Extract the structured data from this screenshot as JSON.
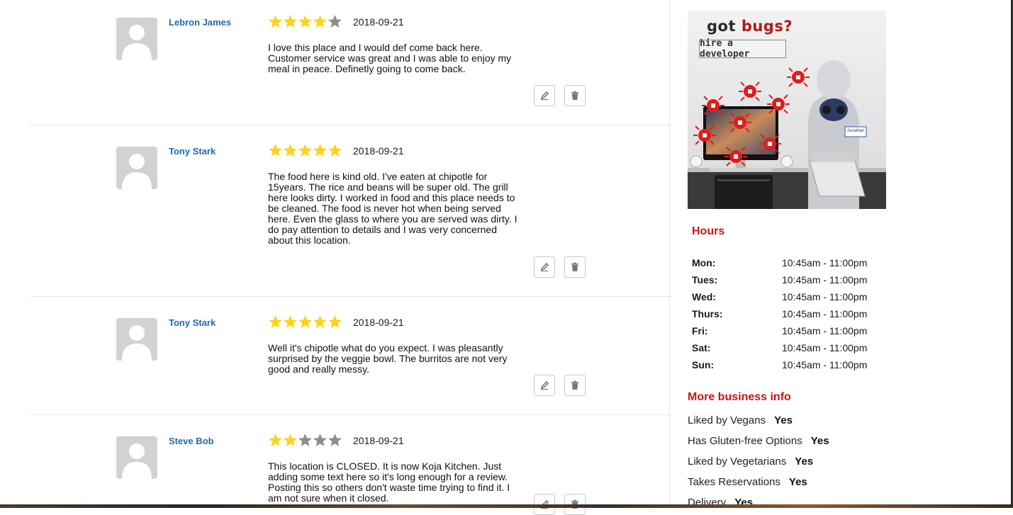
{
  "reviews": [
    {
      "name": "Lebron James",
      "rating": 4,
      "date": "2018-09-21",
      "text": "I love this place and I would def come back here. Customer service was great and I was able to enjoy my meal in peace. Definetly going to come back."
    },
    {
      "name": "Tony Stark",
      "rating": 5,
      "date": "2018-09-21",
      "text": "The food here is kind old. I've eaten at chipotle for 15years. The rice and beans will be super old. The grill here looks dirty. I worked in food and this place needs to be cleaned. The food is never hot when being served here. Even the glass to where you are served was dirty. I do pay attention to details and I was very concerned about this location."
    },
    {
      "name": "Tony Stark",
      "rating": 5,
      "date": "2018-09-21",
      "text": "Well it's chipotle what do you expect. I was pleasantly surprised by the veggie bowl. The burritos are not very good and really messy."
    },
    {
      "name": "Steve Bob",
      "rating": 2,
      "date": "2018-09-21",
      "text": "This location is CLOSED. It is now Koja Kitchen. Just adding some text here so it's long enough for a review. Posting this so others don't waste time trying to find it. I am not sure when it closed."
    }
  ],
  "ad": {
    "line1_a": "got ",
    "line1_b": "bugs?",
    "button": "hire a developer",
    "badge": "Jonathan"
  },
  "hours": {
    "title": "Hours",
    "rows": [
      {
        "day": "Mon:",
        "time": "10:45am - 11:00pm"
      },
      {
        "day": "Tues:",
        "time": "10:45am - 11:00pm"
      },
      {
        "day": "Wed:",
        "time": "10:45am - 11:00pm"
      },
      {
        "day": "Thurs:",
        "time": "10:45am - 11:00pm"
      },
      {
        "day": "Fri:",
        "time": "10:45am - 11:00pm"
      },
      {
        "day": "Sat:",
        "time": "10:45am - 11:00pm"
      },
      {
        "day": "Sun:",
        "time": "10:45am - 11:00pm"
      }
    ]
  },
  "business_info": {
    "title": "More business info",
    "rows": [
      {
        "label": "Liked by Vegans",
        "value": "Yes"
      },
      {
        "label": "Has Gluten-free Options",
        "value": "Yes"
      },
      {
        "label": "Liked by Vegetarians",
        "value": "Yes"
      },
      {
        "label": "Takes Reservations",
        "value": "Yes"
      },
      {
        "label": "Delivery",
        "value": "Yes"
      }
    ]
  },
  "colors": {
    "star_filled": "#ffd21f",
    "star_empty": "#8c8c8c",
    "link": "#1d6ab4",
    "section_title": "#c91414"
  },
  "icons": {
    "edit": "pencil-icon",
    "delete": "trash-icon",
    "avatar": "user-silhouette-icon"
  }
}
